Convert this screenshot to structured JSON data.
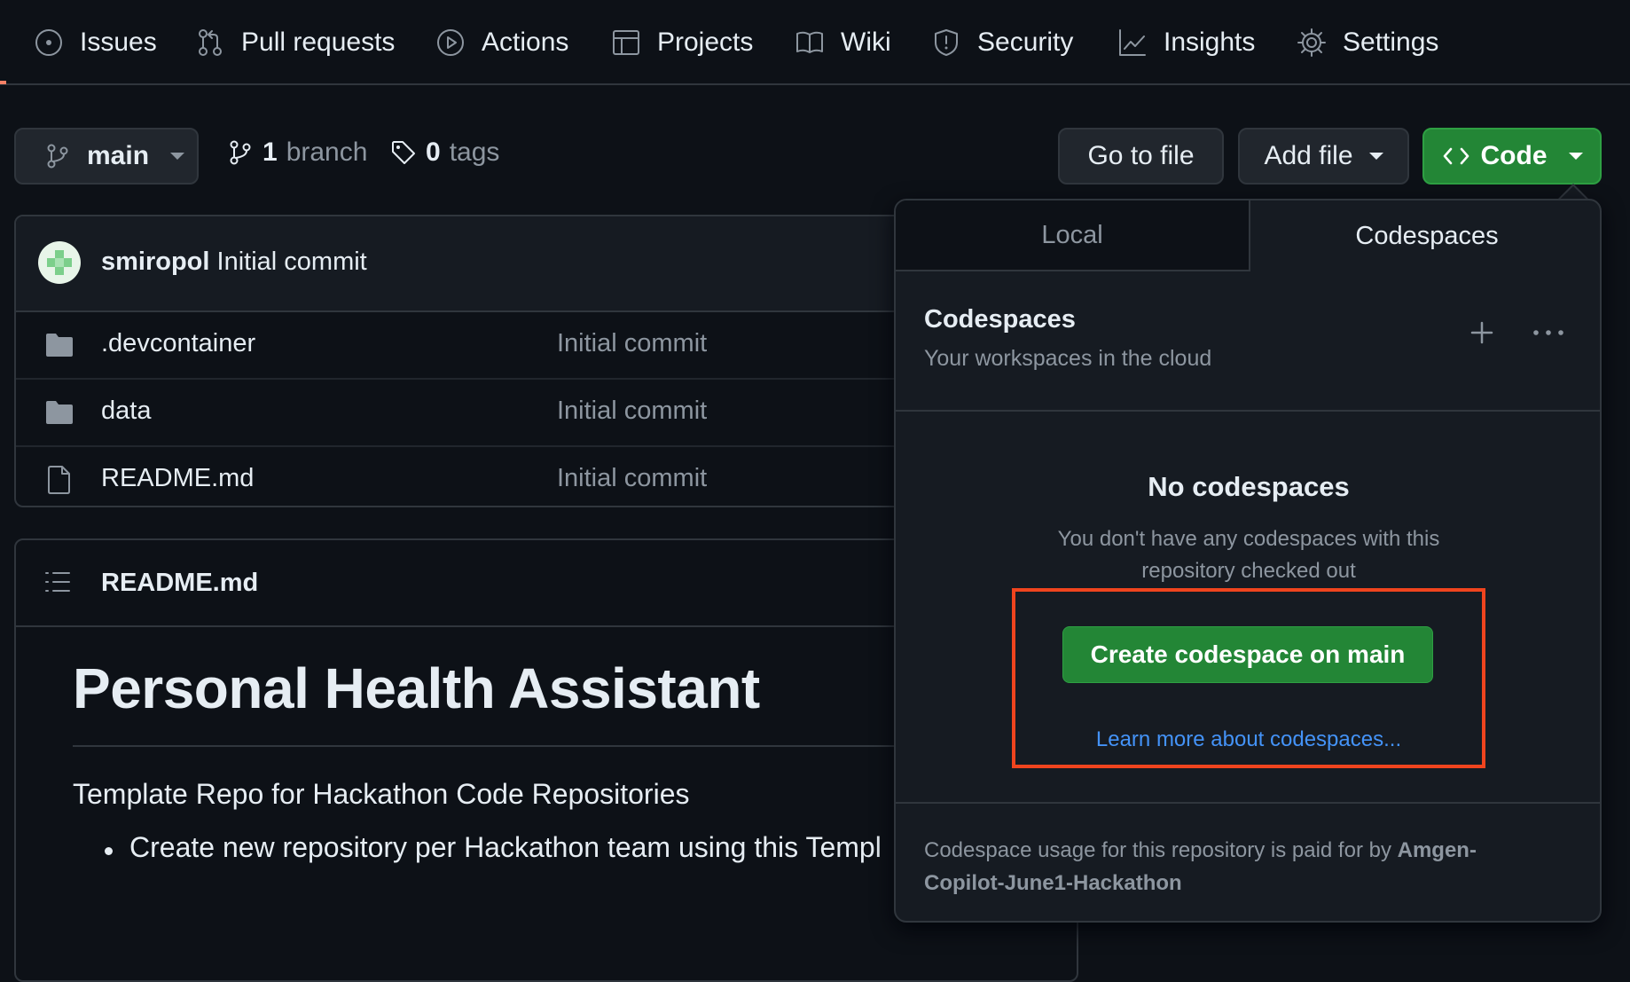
{
  "repo_nav": {
    "issues": "Issues",
    "pull_requests": "Pull requests",
    "actions": "Actions",
    "projects": "Projects",
    "wiki": "Wiki",
    "security": "Security",
    "insights": "Insights",
    "settings": "Settings"
  },
  "branch_bar": {
    "branch": "main",
    "branch_count": "1",
    "branch_label": "branch",
    "tag_count": "0",
    "tag_label": "tags",
    "go_to_file": "Go to file",
    "add_file": "Add file",
    "code": "Code"
  },
  "latest_commit": {
    "author": "smiropol",
    "message": "Initial commit"
  },
  "files": [
    {
      "name": ".devcontainer",
      "type": "folder",
      "message": "Initial commit"
    },
    {
      "name": "data",
      "type": "folder",
      "message": "Initial commit"
    },
    {
      "name": "README.md",
      "type": "file",
      "message": "Initial commit"
    }
  ],
  "readme": {
    "filename": "README.md",
    "title": "Personal Health Assistant",
    "paragraph": "Template Repo for Hackathon Code Repositories",
    "bullet": "Create new repository per Hackathon team using this Templ"
  },
  "code_dropdown": {
    "tabs": [
      "Local",
      "Codespaces"
    ],
    "active_tab": "Codespaces",
    "header_title": "Codespaces",
    "header_subtitle": "Your workspaces in the cloud",
    "empty_title": "No codespaces",
    "empty_line1": "You don't have any codespaces with this",
    "empty_line2": "repository checked out",
    "create_button": "Create codespace on main",
    "learn_more": "Learn more about codespaces...",
    "footer_text": "Codespace usage for this repository is paid for by",
    "footer_org_line1": "Amgen-",
    "footer_org_line2": "Copilot-June1-Hackathon"
  },
  "colors": {
    "background": "#0d1117",
    "accent_green": "#238636",
    "link_blue": "#4493f8",
    "highlight_red": "#f0441e",
    "nav_underline": "#f78166"
  }
}
